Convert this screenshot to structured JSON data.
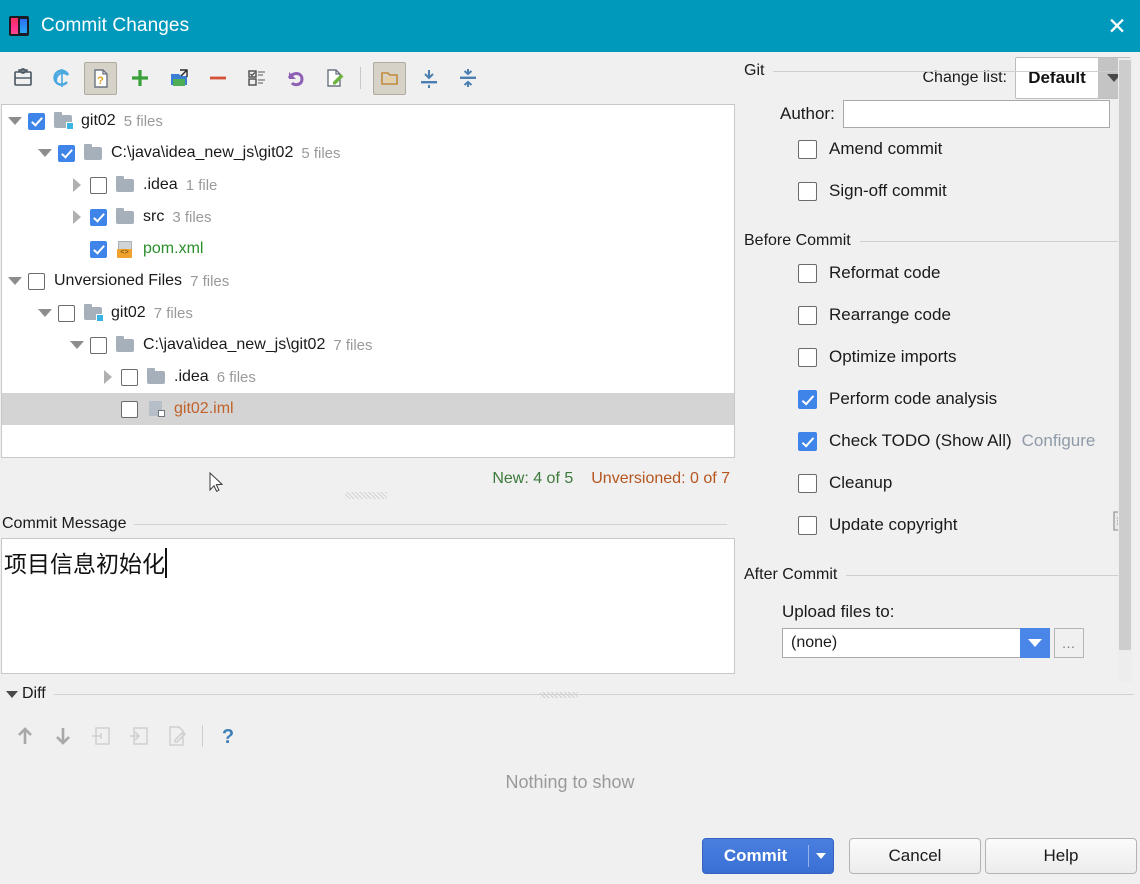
{
  "window": {
    "title": "Commit Changes",
    "app_icon": "intellij-idea-icon",
    "close_label": "✕",
    "titlebar_color": "#0099bc"
  },
  "toolbar": {
    "icons": [
      {
        "name": "refresh-changes-icon",
        "pressed": false
      },
      {
        "name": "rollback-sync-icon",
        "pressed": false
      },
      {
        "name": "show-unversioned-files-icon",
        "pressed": true
      },
      {
        "name": "add-to-vcs-icon",
        "pressed": false
      },
      {
        "name": "move-to-another-changelist-icon",
        "pressed": false
      },
      {
        "name": "delete-icon",
        "pressed": false
      },
      {
        "name": "group-by-icon",
        "pressed": false
      },
      {
        "name": "revert-icon",
        "pressed": false
      },
      {
        "name": "show-diff-icon",
        "pressed": false
      },
      {
        "name": "group-by-directory-icon",
        "pressed": true
      },
      {
        "name": "expand-all-icon",
        "pressed": false
      },
      {
        "name": "collapse-all-icon",
        "pressed": false
      }
    ],
    "changelist_label": "Change list:",
    "changelist_label_mnemonic": "l",
    "changelist_value": "Default"
  },
  "tree": {
    "rows": [
      {
        "indent": 0,
        "twisty": "down",
        "checked": "on",
        "icon": "module-folder-icon",
        "name": "git02",
        "name_color": "default",
        "count": "5 files",
        "selected": false
      },
      {
        "indent": 1,
        "twisty": "down",
        "checked": "on",
        "icon": "folder-icon",
        "name": "C:\\java\\idea_new_js\\git02",
        "name_color": "default",
        "count": "5 files",
        "selected": false
      },
      {
        "indent": 2,
        "twisty": "right",
        "checked": "off",
        "icon": "folder-icon",
        "name": ".idea",
        "name_color": "default",
        "count": "1 file",
        "selected": false
      },
      {
        "indent": 2,
        "twisty": "right",
        "checked": "on",
        "icon": "folder-icon",
        "name": "src",
        "name_color": "default",
        "count": "3 files",
        "selected": false
      },
      {
        "indent": 2,
        "twisty": "none",
        "checked": "on",
        "icon": "xml-file-icon",
        "name": "pom.xml",
        "name_color": "green",
        "count": "",
        "selected": false
      },
      {
        "indent": 0,
        "twisty": "down",
        "checked": "off",
        "icon": "none",
        "name": "Unversioned Files",
        "name_color": "default",
        "count": "7 files",
        "selected": false
      },
      {
        "indent": 1,
        "twisty": "down",
        "checked": "off",
        "icon": "module-folder-icon",
        "name": "git02",
        "name_color": "default",
        "count": "7 files",
        "selected": false
      },
      {
        "indent": 2,
        "twisty": "down",
        "checked": "off",
        "icon": "folder-icon",
        "name": "C:\\java\\idea_new_js\\git02",
        "name_color": "default",
        "count": "7 files",
        "selected": false
      },
      {
        "indent": 3,
        "twisty": "right",
        "checked": "off",
        "icon": "folder-icon",
        "name": ".idea",
        "name_color": "default",
        "count": "6 files",
        "selected": false
      },
      {
        "indent": 3,
        "twisty": "none",
        "checked": "off",
        "icon": "iml-file-icon",
        "name": "git02.iml",
        "name_color": "orange",
        "count": "",
        "selected": true
      }
    ],
    "status_new": "New: 4 of 5",
    "status_unversioned": "Unversioned: 0 of 7",
    "status_new_color": "#3c7a3c",
    "status_unversioned_color": "#b5551f"
  },
  "commit_message": {
    "label": "Commit Message",
    "label_mnemonic": "C",
    "value": "项目信息初始化",
    "history_icon": "commit-message-history-icon"
  },
  "git_section": {
    "title": "Git",
    "author_label": "Author:",
    "author_mnemonic": "A",
    "author_value": "",
    "checkboxes": [
      {
        "label": "Amend commit",
        "mnemonic": "m",
        "checked": false,
        "name": "amend-commit"
      },
      {
        "label": "Sign-off commit",
        "mnemonic": "g",
        "checked": false,
        "name": "sign-off-commit"
      }
    ]
  },
  "before_commit": {
    "title": "Before Commit",
    "checkboxes": [
      {
        "label": "Reformat code",
        "mnemonic": "R",
        "checked": false,
        "name": "reformat-code"
      },
      {
        "label": "Rearrange code",
        "mnemonic": "n",
        "checked": false,
        "name": "rearrange-code"
      },
      {
        "label": "Optimize imports",
        "mnemonic": "O",
        "checked": false,
        "name": "optimize-imports"
      },
      {
        "label": "Perform code analysis",
        "mnemonic": "s",
        "checked": true,
        "name": "perform-code-analysis"
      },
      {
        "label": "Check TODO (Show All)",
        "mnemonic": "",
        "checked": true,
        "name": "check-todo",
        "link": "Configure"
      },
      {
        "label": "Cleanup",
        "mnemonic": "l",
        "checked": false,
        "name": "cleanup"
      },
      {
        "label": "Update copyright",
        "mnemonic": "",
        "checked": false,
        "name": "update-copyright"
      }
    ],
    "link_color": "#8f9aa8"
  },
  "after_commit": {
    "title": "After Commit",
    "upload_label": "Upload files to:",
    "upload_value": "(none)",
    "browse_label": "…"
  },
  "diff": {
    "label": "Diff",
    "icons": [
      {
        "name": "previous-difference-icon"
      },
      {
        "name": "next-difference-icon"
      },
      {
        "name": "revert-change-icon"
      },
      {
        "name": "apply-change-icon"
      },
      {
        "name": "edit-source-icon"
      },
      {
        "name": "help-question-icon"
      }
    ],
    "empty_text": "Nothing to show"
  },
  "footer": {
    "commit_label": "Commit",
    "commit_mnemonic": "t",
    "cancel_label": "Cancel",
    "help_label": "Help",
    "help_mnemonic": "H",
    "primary_color": "#3a6fd4"
  }
}
